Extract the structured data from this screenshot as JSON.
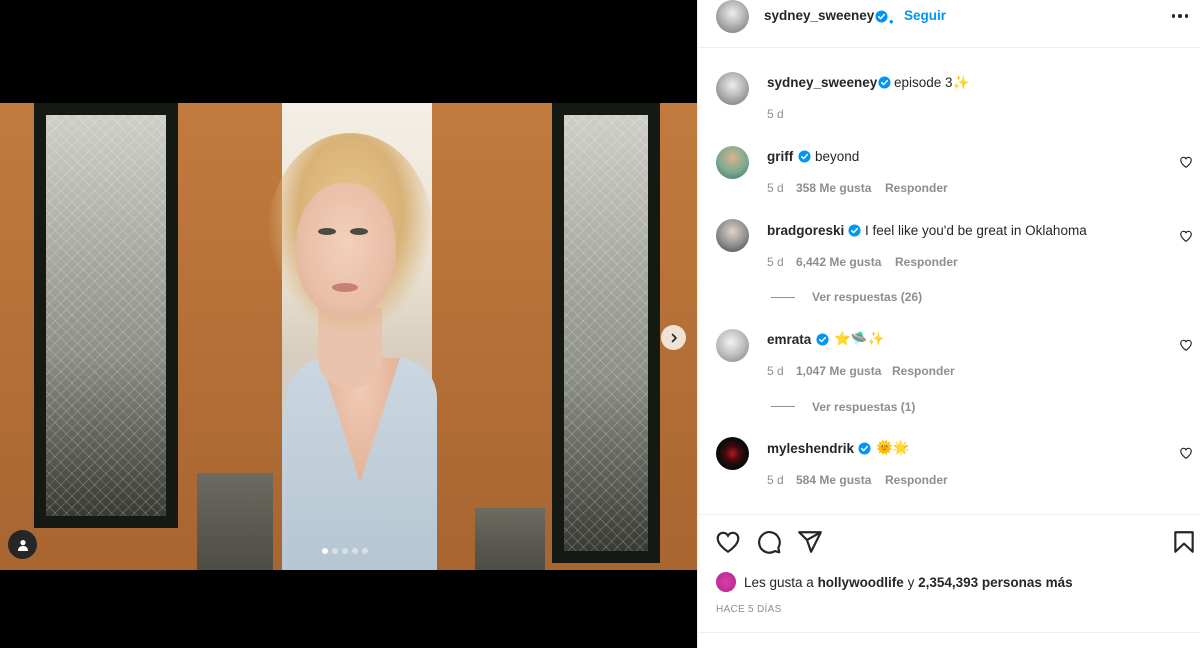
{
  "header": {
    "username": "sydney_sweeney",
    "bullet": "•",
    "follow_label": "Seguir",
    "more_icon": "more-options-icon"
  },
  "caption": {
    "username": "sydney_sweeney",
    "text": "episode 3✨",
    "time": "5 d"
  },
  "comments": [
    {
      "username": "griff",
      "verified": true,
      "text": "beyond",
      "time": "5 d",
      "likes": "358 Me gusta",
      "reply_label": "Responder"
    },
    {
      "username": "bradgoreski",
      "verified": true,
      "text": "I feel like you'd be great in Oklahoma",
      "time": "5 d",
      "likes": "6,442 Me gusta",
      "reply_label": "Responder",
      "view_replies": "Ver respuestas (26)"
    },
    {
      "username": "emrata",
      "verified": true,
      "text": "⭐🛸✨",
      "time": "5 d",
      "likes": "1,047 Me gusta",
      "reply_label": "Responder",
      "view_replies": "Ver respuestas (1)"
    },
    {
      "username": "myleshendrik",
      "verified": true,
      "text": "🌞🌟",
      "time": "5 d",
      "likes": "584 Me gusta",
      "reply_label": "Responder"
    }
  ],
  "actions": {
    "likes_prefix": "Les gusta a ",
    "likes_user": "hollywoodlife",
    "likes_middle": " y ",
    "likes_count": "2,354,393 personas más",
    "timestamp": "Hace 5 días"
  },
  "carousel": {
    "slides": 5,
    "current": 1
  },
  "colors": {
    "accent": "#0095f6",
    "verified": "#0095f6",
    "secondary_text": "#8e8e8e"
  }
}
